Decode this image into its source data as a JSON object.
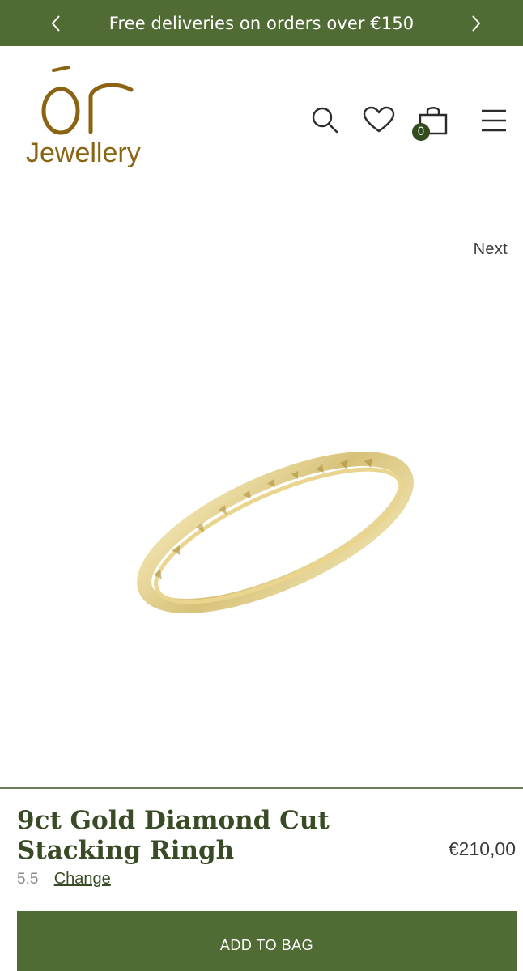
{
  "announcement": {
    "text": "Free deliveries on orders over €150",
    "prev_icon": "chevron-left-icon",
    "next_icon": "chevron-right-icon"
  },
  "brand": {
    "logo_mark": "ór",
    "logo_word": "Jewellery",
    "color": "#8a6413"
  },
  "header": {
    "icons": [
      "search-icon",
      "heart-icon",
      "shopping-bag-icon",
      "menu-icon"
    ],
    "cart_count": "0"
  },
  "product": {
    "next_label": "Next",
    "title": "9ct Gold Diamond Cut Stacking Ringh",
    "price": "€210,00",
    "size": "5.5",
    "change_label": "Change",
    "add_to_bag_label": "ADD TO BAG"
  },
  "colors": {
    "accent_green": "#516b35",
    "title_green": "#384b25",
    "gold": "#d4c07a"
  }
}
